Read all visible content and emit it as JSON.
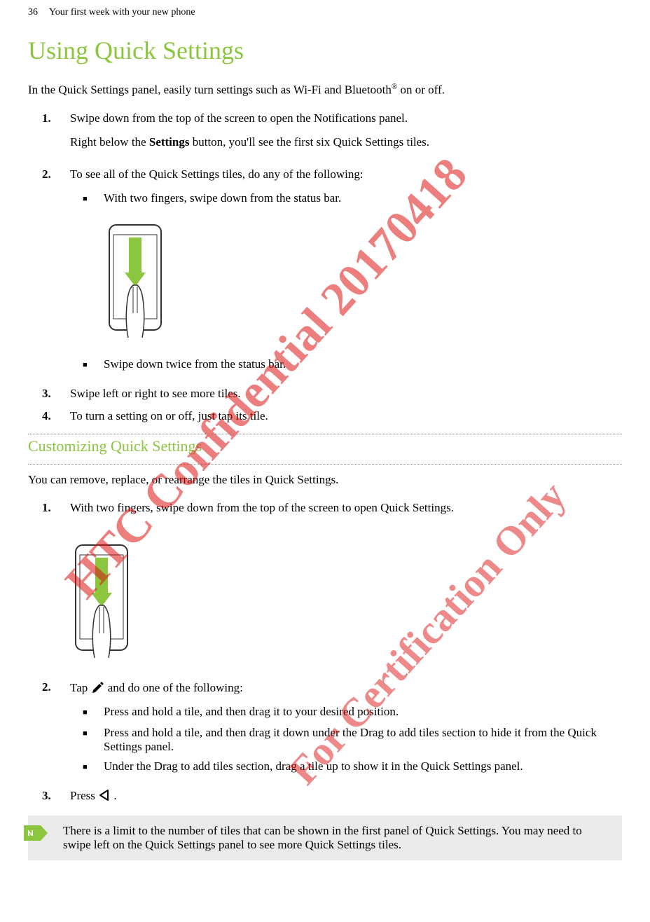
{
  "header": {
    "page_num": "36",
    "section": "Your first week with your new phone"
  },
  "section1": {
    "title": "Using Quick Settings",
    "intro_pre": "In the Quick Settings panel, easily turn settings such as Wi-Fi and Bluetooth",
    "intro_post": " on or off.",
    "steps": {
      "s1_a": "Swipe down from the top of the screen to open the Notifications panel.",
      "s1_b_pre": "Right below the ",
      "s1_b_bold": "Settings",
      "s1_b_post": " button, you'll see the first six Quick Settings tiles.",
      "s2": "To see all of the Quick Settings tiles, do any of the following:",
      "s2_b1": "With two fingers, swipe down from the status bar.",
      "s2_b2": "Swipe down twice from the status bar.",
      "s3": "Swipe left or right to see more tiles.",
      "s4": "To turn a setting on or off, just tap its tile."
    }
  },
  "section2": {
    "title": "Customizing Quick Settings",
    "intro": "You can remove, replace, or rearrange the tiles in Quick Settings.",
    "steps": {
      "s1": "With two fingers, swipe down from the top of the screen to open Quick Settings.",
      "s2_pre": "Tap ",
      "s2_post": " and do one of the following:",
      "s2_b1": "Press and hold a tile, and then drag it to your desired position.",
      "s2_b2": "Press and hold a tile, and then drag it down under the Drag to add tiles section to hide it from the Quick Settings panel.",
      "s2_b3": "Under the Drag to add tiles section, drag a tile up to show it in the Quick Settings panel.",
      "s3_pre": "Press ",
      "s3_post": " ."
    }
  },
  "note": "There is a limit to the number of tiles that can be shown in the first panel of Quick Settings. You may need to swipe left on the Quick Settings panel to see more Quick Settings tiles.",
  "watermarks": {
    "wm1": "HTC Confidential 20170418",
    "wm2": "For Certification Only"
  }
}
